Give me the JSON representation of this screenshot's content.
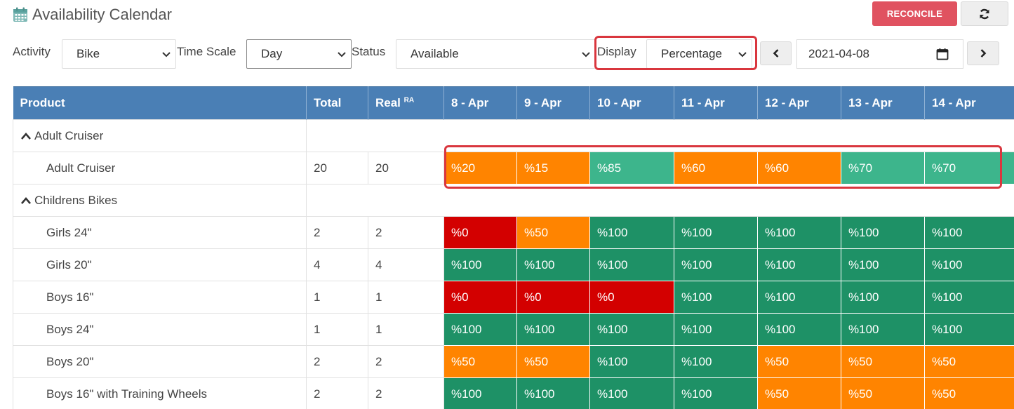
{
  "header": {
    "title": "Availability Calendar",
    "reconcile_label": "RECONCILE"
  },
  "filters": {
    "activity_label": "Activity",
    "activity_value": "Bike",
    "timescale_label": "Time Scale",
    "timescale_value": "Day",
    "status_label": "Status",
    "status_value": "Available",
    "display_label": "Display",
    "display_value": "Percentage",
    "date_value": "2021-04-08"
  },
  "table": {
    "headers": {
      "product": "Product",
      "total": "Total",
      "real": "Real",
      "real_sup": "RA",
      "days": [
        "8 - Apr",
        "9 - Apr",
        "10 - Apr",
        "11 - Apr",
        "12 - Apr",
        "13 - Apr",
        "14 - Apr"
      ]
    },
    "groups": [
      {
        "name": "Adult Cruiser",
        "rows": [
          {
            "name": "Adult Cruiser",
            "total": "20",
            "real": "20",
            "cells": [
              {
                "v": "%20",
                "s": "orange"
              },
              {
                "v": "%15",
                "s": "orange"
              },
              {
                "v": "%85",
                "s": "mint"
              },
              {
                "v": "%60",
                "s": "orange"
              },
              {
                "v": "%60",
                "s": "orange"
              },
              {
                "v": "%70",
                "s": "mint"
              },
              {
                "v": "%70",
                "s": "mint"
              }
            ]
          }
        ]
      },
      {
        "name": "Childrens Bikes",
        "rows": [
          {
            "name": "Girls 24\"",
            "total": "2",
            "real": "2",
            "cells": [
              {
                "v": "%0",
                "s": "red"
              },
              {
                "v": "%50",
                "s": "orange"
              },
              {
                "v": "%100",
                "s": "green"
              },
              {
                "v": "%100",
                "s": "green"
              },
              {
                "v": "%100",
                "s": "green"
              },
              {
                "v": "%100",
                "s": "green"
              },
              {
                "v": "%100",
                "s": "green"
              }
            ]
          },
          {
            "name": "Girls 20\"",
            "total": "4",
            "real": "4",
            "cells": [
              {
                "v": "%100",
                "s": "green"
              },
              {
                "v": "%100",
                "s": "green"
              },
              {
                "v": "%100",
                "s": "green"
              },
              {
                "v": "%100",
                "s": "green"
              },
              {
                "v": "%100",
                "s": "green"
              },
              {
                "v": "%100",
                "s": "green"
              },
              {
                "v": "%100",
                "s": "green"
              }
            ]
          },
          {
            "name": "Boys 16\"",
            "total": "1",
            "real": "1",
            "cells": [
              {
                "v": "%0",
                "s": "red"
              },
              {
                "v": "%0",
                "s": "red"
              },
              {
                "v": "%0",
                "s": "red"
              },
              {
                "v": "%100",
                "s": "green"
              },
              {
                "v": "%100",
                "s": "green"
              },
              {
                "v": "%100",
                "s": "green"
              },
              {
                "v": "%100",
                "s": "green"
              }
            ]
          },
          {
            "name": "Boys 24\"",
            "total": "1",
            "real": "1",
            "cells": [
              {
                "v": "%100",
                "s": "green"
              },
              {
                "v": "%100",
                "s": "green"
              },
              {
                "v": "%100",
                "s": "green"
              },
              {
                "v": "%100",
                "s": "green"
              },
              {
                "v": "%100",
                "s": "green"
              },
              {
                "v": "%100",
                "s": "green"
              },
              {
                "v": "%100",
                "s": "green"
              }
            ]
          },
          {
            "name": "Boys 20\"",
            "total": "2",
            "real": "2",
            "cells": [
              {
                "v": "%50",
                "s": "orange"
              },
              {
                "v": "%50",
                "s": "orange"
              },
              {
                "v": "%100",
                "s": "green"
              },
              {
                "v": "%100",
                "s": "green"
              },
              {
                "v": "%50",
                "s": "orange"
              },
              {
                "v": "%50",
                "s": "orange"
              },
              {
                "v": "%50",
                "s": "orange"
              }
            ]
          },
          {
            "name": "Boys 16\" with Training Wheels",
            "total": "2",
            "real": "2",
            "cells": [
              {
                "v": "%100",
                "s": "green"
              },
              {
                "v": "%100",
                "s": "green"
              },
              {
                "v": "%100",
                "s": "green"
              },
              {
                "v": "%100",
                "s": "green"
              },
              {
                "v": "%50",
                "s": "orange"
              },
              {
                "v": "%50",
                "s": "orange"
              },
              {
                "v": "%50",
                "s": "orange"
              }
            ]
          }
        ]
      }
    ]
  },
  "colors": {
    "header_bg": "#4a7fb5",
    "reconcile_bg": "#e05260",
    "red": "#d30000",
    "orange": "#ff8400",
    "green": "#1e9166",
    "mint": "#3db58c",
    "highlight": "#d9363e"
  },
  "icons": {
    "title": "calendar-icon",
    "refresh": "refresh-icon",
    "prev": "chevron-left-icon",
    "next": "chevron-right-icon",
    "date": "calendar-small-icon",
    "group_toggle": "chevron-up-icon"
  }
}
